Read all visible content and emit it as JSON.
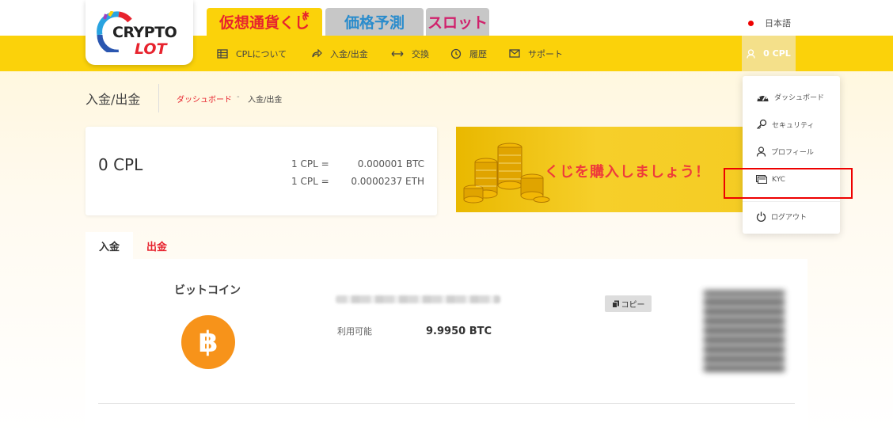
{
  "header": {
    "logo": {
      "line1": "CRYPTO",
      "line2": "LOT"
    },
    "game_tabs": [
      {
        "label": "仮想通貨くじ",
        "active": true
      },
      {
        "label": "価格予測",
        "active": false
      },
      {
        "label": "スロット",
        "active": false
      }
    ],
    "language": "日本語",
    "nav": [
      {
        "label": "CPLについて",
        "icon": "table-icon"
      },
      {
        "label": "入金/出金",
        "icon": "redo-arrow-icon"
      },
      {
        "label": "交換",
        "icon": "exchange-arrows-icon"
      },
      {
        "label": "履歴",
        "icon": "history-icon"
      },
      {
        "label": "サポート",
        "icon": "mail-icon"
      }
    ],
    "balance": "0 CPL"
  },
  "user_menu": {
    "items": [
      {
        "label": "ダッシュボード",
        "icon": "dashboard-gauge-icon"
      },
      {
        "label": "セキュリティ",
        "icon": "key-icon"
      },
      {
        "label": "プロフィール",
        "icon": "user-icon"
      },
      {
        "label": "KYC",
        "icon": "id-card-icon"
      },
      {
        "label": "ログアウト",
        "icon": "power-icon"
      }
    ]
  },
  "page": {
    "title": "入金/出金",
    "breadcrumb": {
      "home": "ダッシュボード",
      "separator": "-",
      "current": "入金/出金"
    }
  },
  "balance_card": {
    "amount": "0 CPL",
    "rates": [
      {
        "label": "1 CPL =",
        "value": "0.000001 BTC"
      },
      {
        "label": "1 CPL =",
        "value": "0.0000237 ETH"
      }
    ]
  },
  "banner": {
    "text": "くじを購入しましょう！"
  },
  "tabs": {
    "deposit": "入金",
    "withdraw": "出金"
  },
  "wallet": {
    "coin_name": "ビットコイン",
    "coin_symbol": "bitcoin-icon",
    "available_label": "利用可能",
    "available_value": "9.9950 BTC",
    "copy_label": "コピー"
  },
  "colors": {
    "brand_yellow": "#fbd20a",
    "brand_red": "#e7232e",
    "bitcoin_orange": "#f7931a",
    "highlight_red": "#ee0000"
  }
}
